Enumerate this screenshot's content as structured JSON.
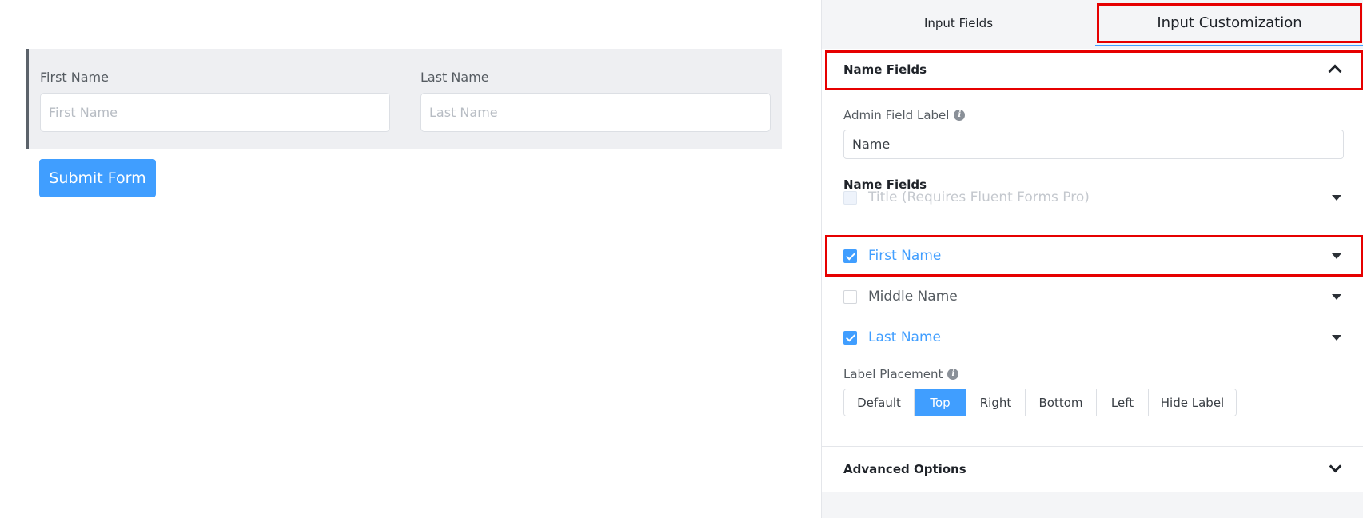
{
  "preview": {
    "first_name_label": "First Name",
    "first_name_placeholder": "First Name",
    "last_name_label": "Last Name",
    "last_name_placeholder": "Last Name",
    "submit_label": "Submit Form"
  },
  "panel": {
    "tabs": [
      {
        "label": "Input Fields",
        "active": false
      },
      {
        "label": "Input Customization",
        "active": true
      }
    ],
    "section_title": "Name Fields",
    "admin_field_label": "Admin Field Label",
    "admin_field_value": "Name",
    "name_fields_heading": "Name Fields",
    "name_fields": [
      {
        "label": "Title (Requires Fluent Forms Pro)",
        "checked": false,
        "disabled": true
      },
      {
        "label": "First Name",
        "checked": true,
        "disabled": false
      },
      {
        "label": "Middle Name",
        "checked": false,
        "disabled": false
      },
      {
        "label": "Last Name",
        "checked": true,
        "disabled": false
      }
    ],
    "label_placement_label": "Label Placement",
    "label_placement_options": [
      "Default",
      "Top",
      "Right",
      "Bottom",
      "Left",
      "Hide Label"
    ],
    "label_placement_selected": "Top",
    "advanced_options_label": "Advanced Options"
  },
  "colors": {
    "accent": "#409eff",
    "highlight": "#e60000"
  }
}
